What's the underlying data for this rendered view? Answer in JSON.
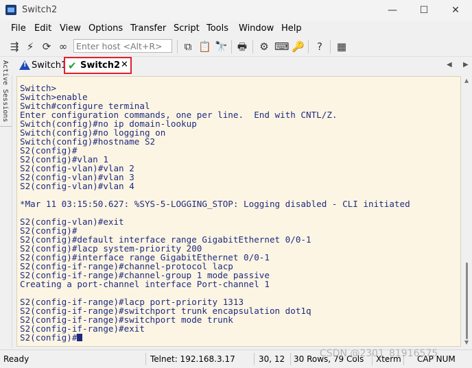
{
  "window": {
    "title": "Switch2",
    "controls": {
      "minimize": "—",
      "maximize": "☐",
      "close": "✕"
    }
  },
  "menu": [
    "File",
    "Edit",
    "View",
    "Options",
    "Transfer",
    "Script",
    "Tools",
    "Window",
    "Help"
  ],
  "toolbar": {
    "quick_connect_placeholder": "Enter host <Alt+R>",
    "icons": [
      "connect-icon",
      "lightning-icon",
      "reconnect-icon",
      "disconnect-icon",
      "copy-icon",
      "paste-icon",
      "find-icon",
      "print-icon",
      "settings-icon",
      "keymap-icon",
      "key-icon",
      "help-icon",
      "sftp-icon"
    ]
  },
  "sidebar": {
    "label": "Active Sessions"
  },
  "tabs": [
    {
      "label": "Switch1",
      "status": "warning"
    },
    {
      "label": "Switch2",
      "status": "connected",
      "active": true,
      "close": "✕"
    }
  ],
  "terminal": {
    "lines": [
      "Switch>",
      "Switch>enable",
      "Switch#configure terminal",
      "Enter configuration commands, one per line.  End with CNTL/Z.",
      "Switch(config)#no ip domain-lookup",
      "Switch(config)#no logging on",
      "Switch(config)#hostname S2",
      "S2(config)#",
      "S2(config)#vlan 1",
      "S2(config-vlan)#vlan 2",
      "S2(config-vlan)#vlan 3",
      "S2(config-vlan)#vlan 4",
      "",
      "*Mar 11 03:15:50.627: %SYS-5-LOGGING_STOP: Logging disabled - CLI initiated",
      "",
      "S2(config-vlan)#exit",
      "S2(config)#",
      "S2(config)#default interface range GigabitEthernet 0/0-1",
      "S2(config)#lacp system-priority 200",
      "S2(config)#interface range GigabitEthernet 0/0-1",
      "S2(config-if-range)#channel-protocol lacp",
      "S2(config-if-range)#channel-group 1 mode passive",
      "Creating a port-channel interface Port-channel 1",
      "",
      "S2(config-if-range)#lacp port-priority 1313",
      "S2(config-if-range)#switchport trunk encapsulation dot1q",
      "S2(config-if-range)#switchport mode trunk",
      "S2(config-if-range)#exit"
    ],
    "prompt": "S2(config)#",
    "colors": {
      "background": "#fcf5e3",
      "text": "#1e2a80"
    }
  },
  "status": {
    "state": "Ready",
    "connection": "Telnet: 192.168.3.17",
    "cursor_pos": "30, 12",
    "size": "30 Rows, 79 Cols",
    "emulation": "Xterm",
    "keys": "CAP NUM"
  },
  "watermark": "CSDN @2301_81916575"
}
